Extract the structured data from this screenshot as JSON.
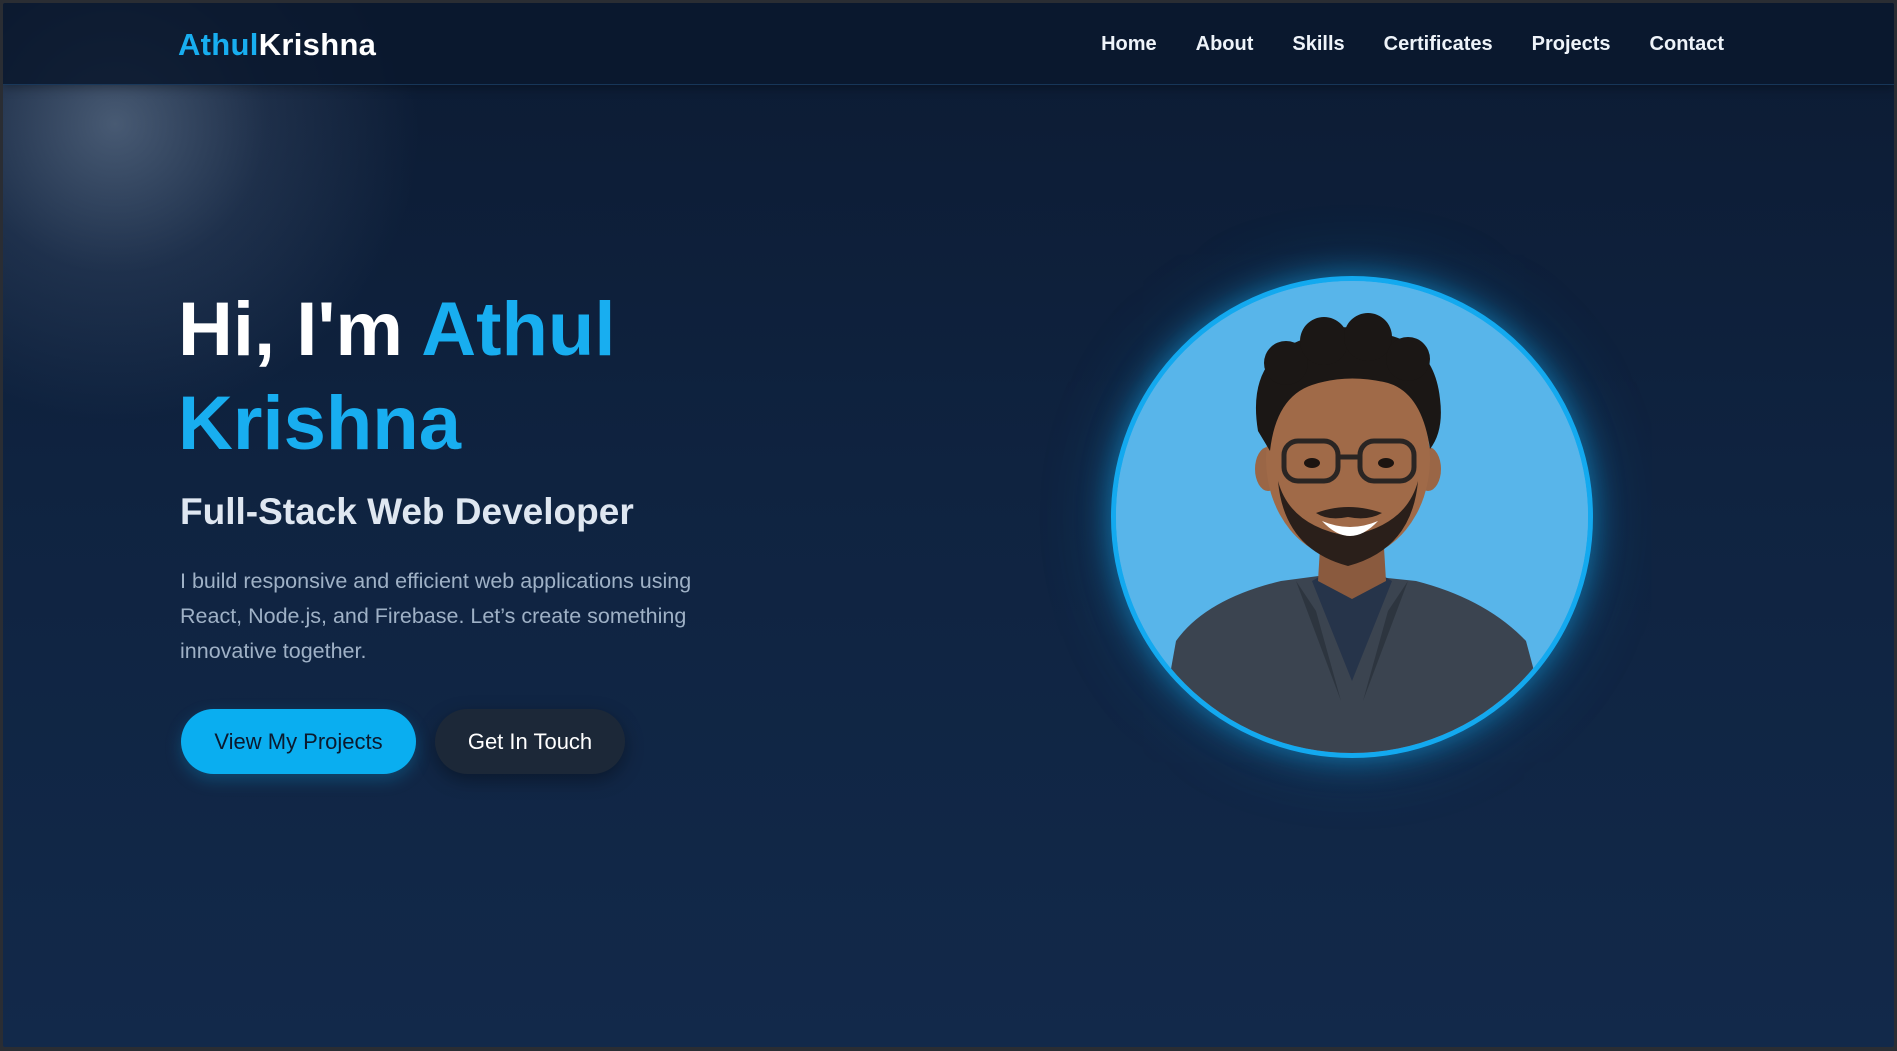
{
  "navbar": {
    "logo_first": "Athul",
    "logo_last": "Krishna",
    "links": [
      "Home",
      "About",
      "Skills",
      "Certificates",
      "Projects",
      "Contact"
    ]
  },
  "hero": {
    "greeting": "Hi, I'm ",
    "name": "Athul Krishna",
    "subtitle": "Full-Stack Web Developer",
    "description": "I build responsive and efficient web applications using React, Node.js, and Firebase. Let’s create something innovative together.",
    "primary_button": "View My Projects",
    "secondary_button": "Get In Touch"
  },
  "profile_photo": {
    "icon": "profile-photo",
    "background_color": "#58b5ea",
    "border_color": "#13a9ef"
  },
  "colors": {
    "accent": "#18aef0",
    "background": "#0f2340",
    "nav_text": "#eef3f9"
  }
}
